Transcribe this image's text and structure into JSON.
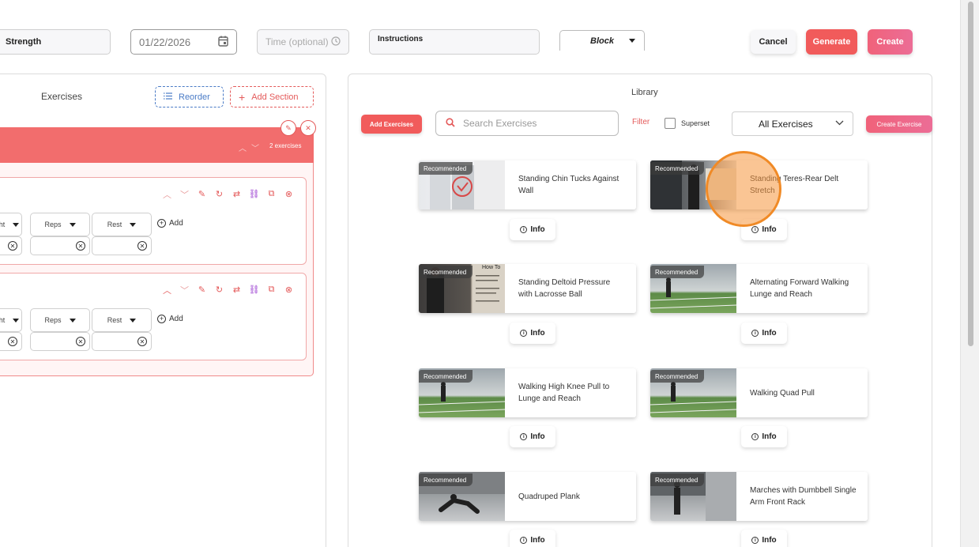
{
  "header": {
    "workout_name": "Strength",
    "date_value": "01/22/2026",
    "time_placeholder": "Time (optional)",
    "instructions_label": "Instructions",
    "block_label": "Block",
    "cancel_label": "Cancel",
    "generate_label": "Generate",
    "create_label": "Create"
  },
  "exercises_panel": {
    "title": "Exercises",
    "reorder_label": "Reorder",
    "add_section_label": "Add Section",
    "section": {
      "count_label": "2 exercises",
      "edit_icon": "pencil-icon",
      "close_icon": "close-icon"
    },
    "cards": [
      {
        "col1": "ght",
        "col2": "Reps",
        "col3": "Rest",
        "add_label": "Add"
      },
      {
        "col1": "ght",
        "col2": "Reps",
        "col3": "Rest",
        "add_label": "Add"
      }
    ]
  },
  "library": {
    "title": "Library",
    "add_exercises_label": "Add Exercises",
    "search_placeholder": "Search Exercises",
    "filter_label": "Filter",
    "superset_label": "Superset",
    "category_value": "All Exercises",
    "create_exercise_label": "Create Exercise",
    "badge_label": "Recommended",
    "info_label": "Info",
    "items": [
      {
        "name": "Standing Chin Tucks Against Wall"
      },
      {
        "name": "Standing Teres-Rear Delt Stretch"
      },
      {
        "name": "Standing Deltoid Pressure with Lacrosse Ball",
        "thumb_text": "How To"
      },
      {
        "name": "Alternating Forward Walking Lunge and Reach"
      },
      {
        "name": "Walking High Knee Pull to Lunge and Reach"
      },
      {
        "name": "Walking Quad Pull"
      },
      {
        "name": "Quadruped Plank"
      },
      {
        "name": "Marches with Dumbbell Single Arm Front Rack"
      }
    ]
  },
  "colors": {
    "accent_red": "#f15b5b",
    "accent_pink": "#ec6d96",
    "section_red": "#f26d6d",
    "link_blue": "#4a7bc6",
    "cursor_orange": "#f08a26"
  }
}
